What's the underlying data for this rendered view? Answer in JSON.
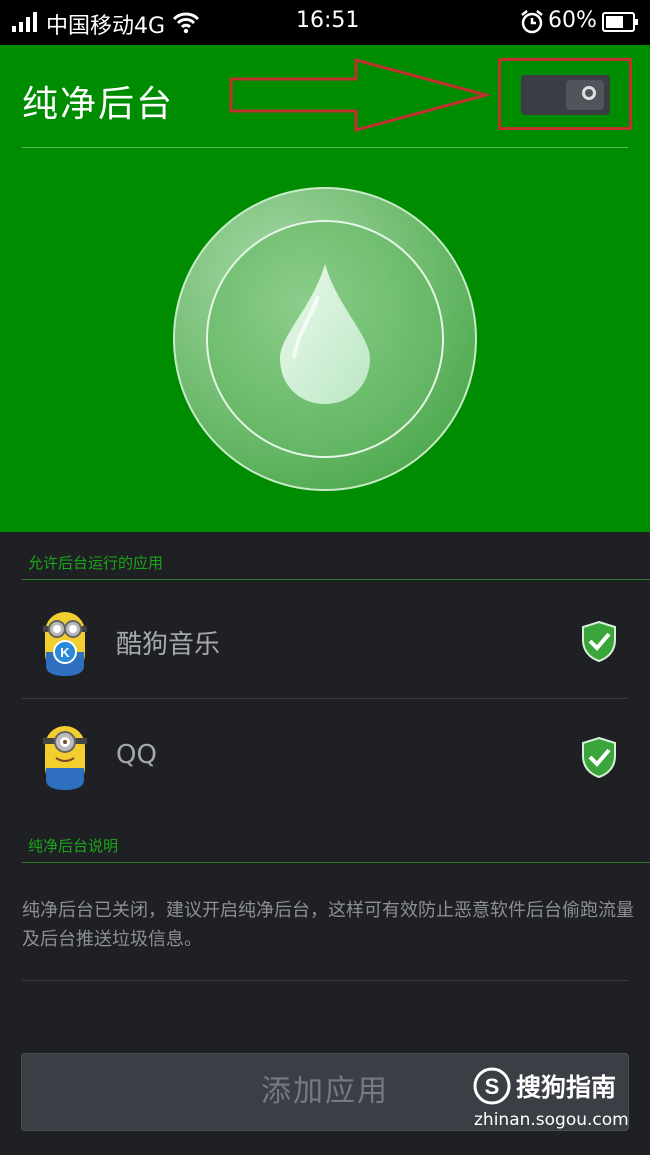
{
  "status_bar": {
    "carrier": "中国移动4G",
    "time": "16:51",
    "battery": "60%",
    "icons": [
      "signal-icon",
      "wifi-icon",
      "alarm-icon",
      "battery-icon"
    ]
  },
  "header": {
    "title": "纯净后台",
    "toggle_state": "off",
    "accent_color": "#008c00",
    "annotation_color": "#c0302f"
  },
  "allowed_section": {
    "label": "允许后台运行的应用",
    "apps": [
      {
        "name": "酷狗音乐",
        "icon": "minion-kugou-avatar",
        "status_icon": "shield-check-icon"
      },
      {
        "name": "QQ",
        "icon": "minion-qq-avatar",
        "status_icon": "shield-check-icon"
      }
    ]
  },
  "info_section": {
    "label": "纯净后台说明",
    "text": "纯净后台已关闭，建议开启纯净后台，这样可有效防止恶意软件后台偷跑流量及后台推送垃圾信息。"
  },
  "add_button": {
    "label": "添加应用"
  },
  "watermark": {
    "title": "搜狗指南",
    "url": "zhinan.sogou.com"
  }
}
